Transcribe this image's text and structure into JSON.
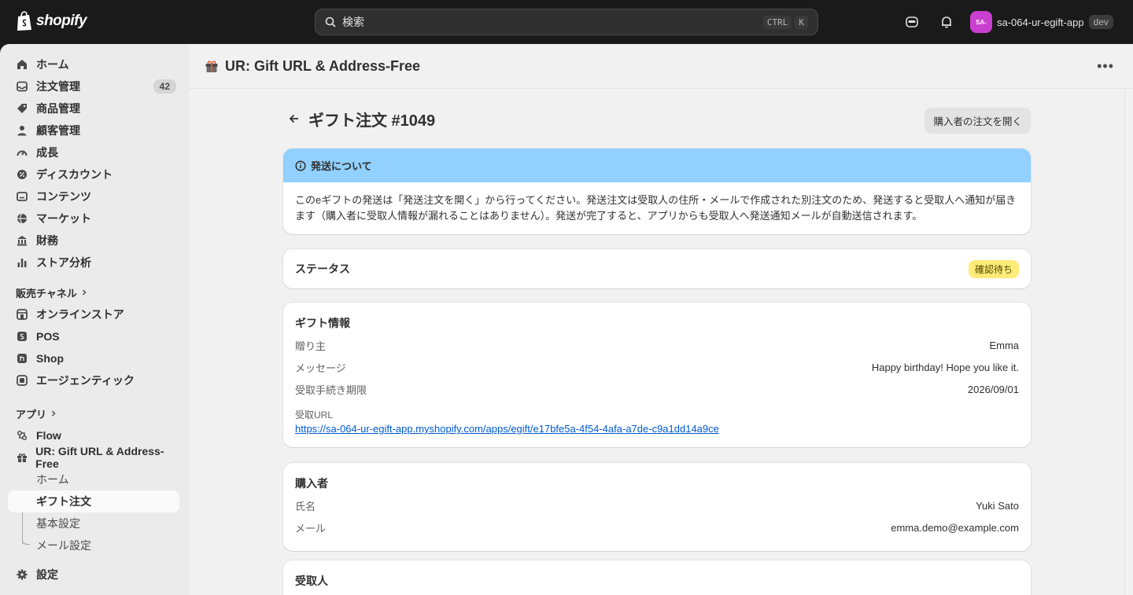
{
  "topbar": {
    "logo_text": "shopify",
    "search_placeholder": "検索",
    "shortcut_keys": [
      "CTRL",
      "K"
    ],
    "store_initials": "SA-",
    "store_name": "sa-064-ur-egift-app",
    "env_badge": "dev"
  },
  "sidebar": {
    "items": [
      {
        "label": "ホーム",
        "icon": "home-icon"
      },
      {
        "label": "注文管理",
        "icon": "inbox-icon",
        "count": "42"
      },
      {
        "label": "商品管理",
        "icon": "tag-icon"
      },
      {
        "label": "顧客管理",
        "icon": "person-icon"
      },
      {
        "label": "成長",
        "icon": "gauge-icon"
      },
      {
        "label": "ディスカウント",
        "icon": "discount-icon"
      },
      {
        "label": "コンテンツ",
        "icon": "content-icon"
      },
      {
        "label": "マーケット",
        "icon": "globe-icon"
      },
      {
        "label": "財務",
        "icon": "bank-icon"
      },
      {
        "label": "ストア分析",
        "icon": "chart-icon"
      }
    ],
    "sales_channels_label": "販売チャネル",
    "channels": [
      {
        "label": "オンラインストア",
        "icon": "store-icon"
      },
      {
        "label": "POS",
        "icon": "pos-icon"
      },
      {
        "label": "Shop",
        "icon": "shop-icon"
      },
      {
        "label": "エージェンティック",
        "icon": "agentic-icon"
      }
    ],
    "apps_label": "アプリ",
    "apps": [
      {
        "label": "Flow",
        "icon": "flow-icon"
      },
      {
        "label": "UR: Gift URL & Address-Free",
        "icon": "gift-icon"
      }
    ],
    "app_subitems": [
      "ホーム",
      "ギフト注文",
      "基本設定",
      "メール設定"
    ],
    "settings_label": "設定"
  },
  "app_header": {
    "title": "UR: Gift URL & Address-Free"
  },
  "page": {
    "title": "ギフト注文 #1049",
    "open_buyer_order_button": "購入者の注文を開く"
  },
  "banner": {
    "title": "発送について",
    "body": "このeギフトの発送は「発送注文を開く」から行ってください。発送注文は受取人の住所・メールで作成された別注文のため、発送すると受取人へ通知が届きます（購入者に受取人情報が漏れることはありません）。発送が完了すると、アプリからも受取人へ発送通知メールが自動送信されます。",
    "color": "#91d0ff"
  },
  "status": {
    "label": "ステータス",
    "value": "確認待ち",
    "badge_color": "#ffeb78"
  },
  "gift_info": {
    "title": "ギフト情報",
    "rows": [
      {
        "key": "贈り主",
        "value": "Emma"
      },
      {
        "key": "メッセージ",
        "value": "Happy birthday! Hope you like it."
      },
      {
        "key": "受取手続き期限",
        "value": "2026/09/01"
      }
    ],
    "url_label": "受取URL",
    "url": "https://sa-064-ur-egift-app.myshopify.com/apps/egift/e17bfe5a-4f54-4afa-a7de-c9a1dd14a9ce"
  },
  "buyer": {
    "title": "購入者",
    "rows": [
      {
        "key": "氏名",
        "value": "Yuki Sato"
      },
      {
        "key": "メール",
        "value": "emma.demo@example.com"
      }
    ]
  },
  "recipient": {
    "title": "受取人"
  }
}
